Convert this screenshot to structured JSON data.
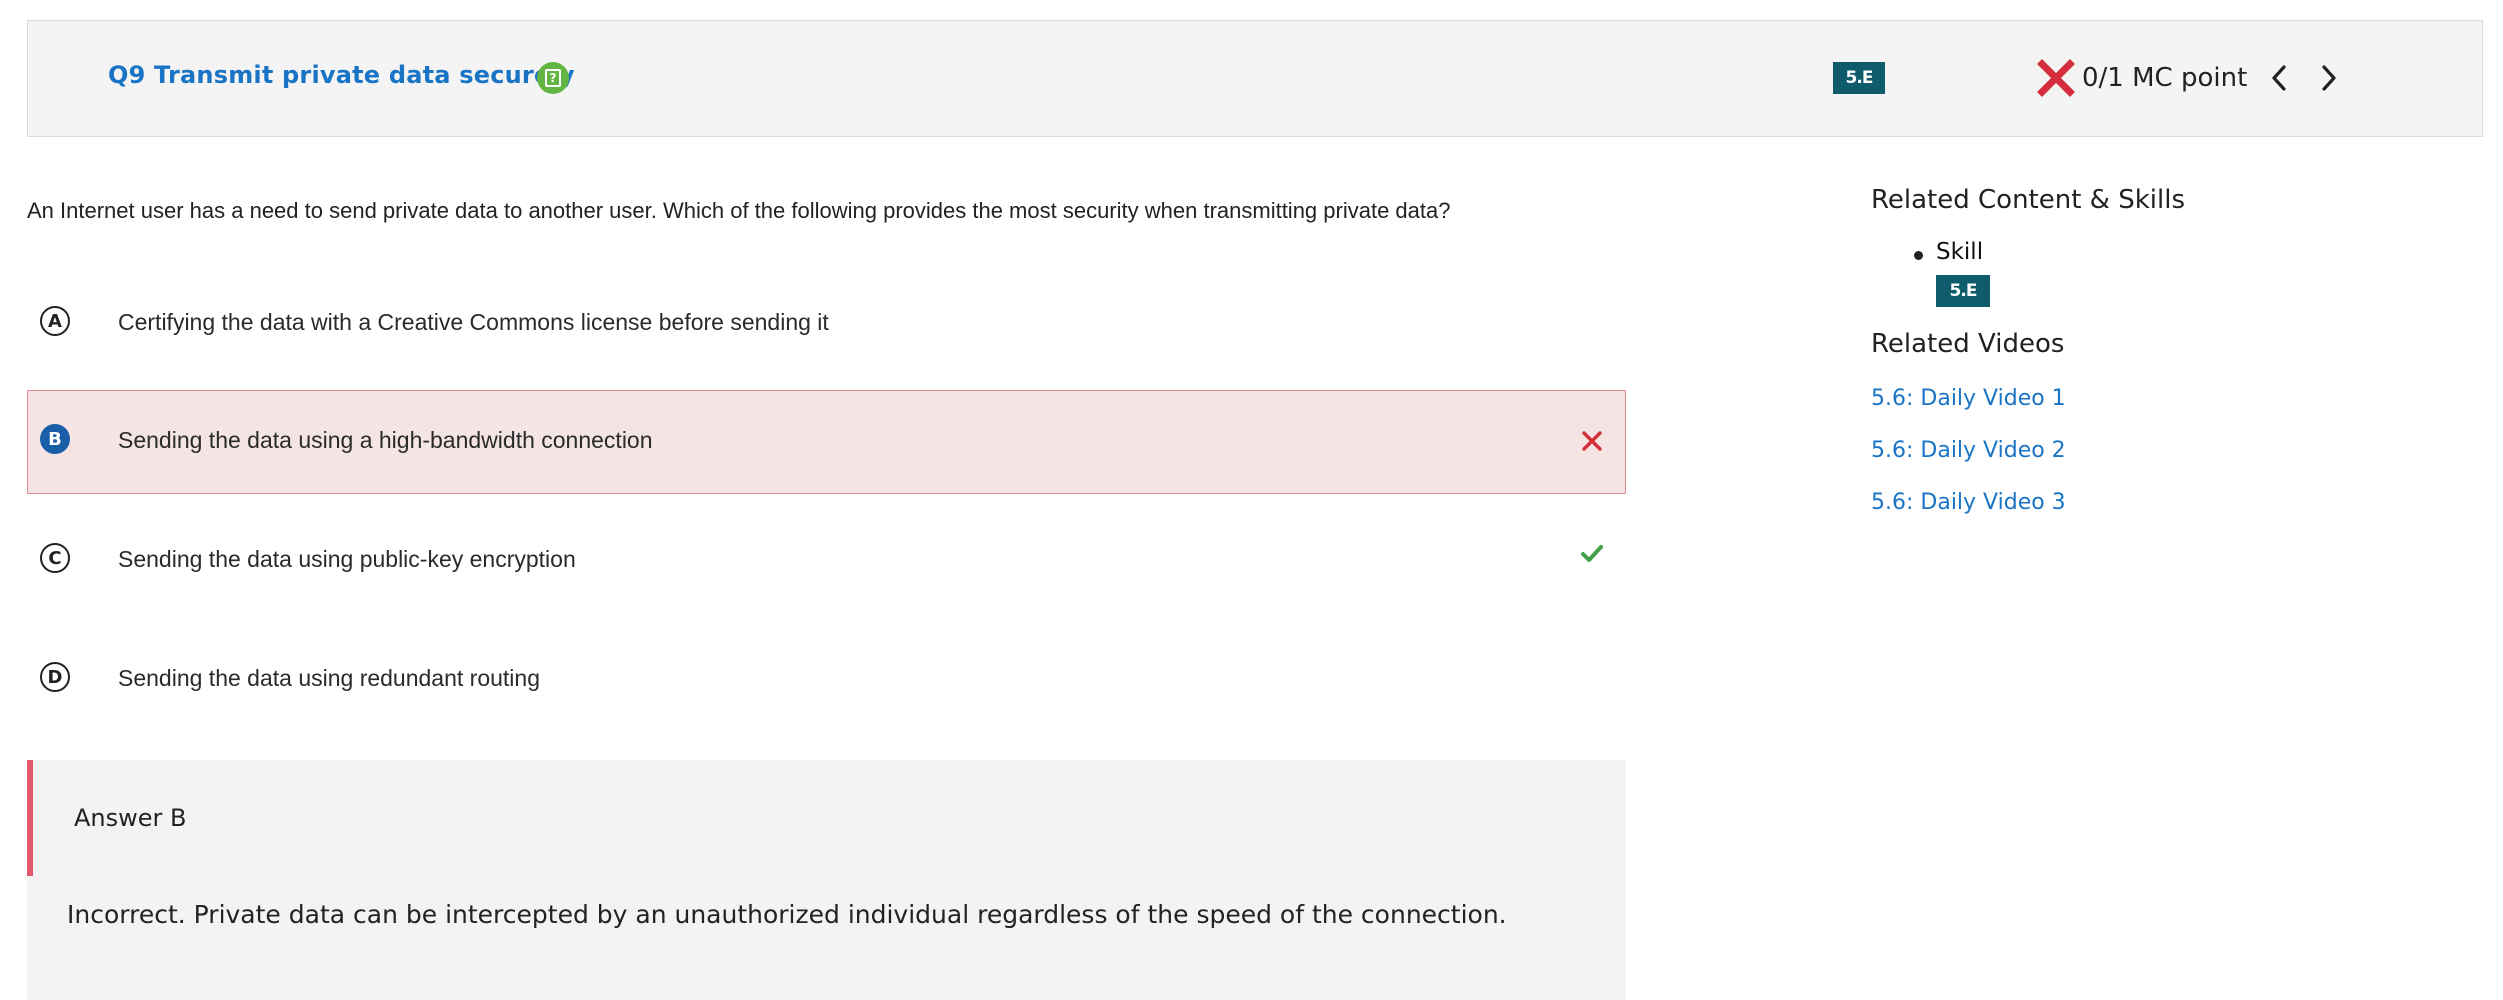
{
  "header": {
    "question_title": "Q9 Transmit private data securely",
    "skill_code": "5.E",
    "score_text": "0/1 MC point",
    "icons": {
      "question_status": "clipboard-question-icon",
      "result": "red-x-icon",
      "prev": "chevron-left-icon",
      "next": "chevron-right-icon"
    }
  },
  "question": {
    "text": "An Internet user has a need to send private data to another user. Which of the following provides the most security when transmitting private data?"
  },
  "options": [
    {
      "letter": "A",
      "text": "Certifying the data with a Creative Commons license before sending it",
      "state": "none"
    },
    {
      "letter": "B",
      "text": "Sending the data using a high-bandwidth connection",
      "state": "selected-incorrect"
    },
    {
      "letter": "C",
      "text": "Sending the data using public-key encryption",
      "state": "correct"
    },
    {
      "letter": "D",
      "text": "Sending the data using redundant routing",
      "state": "none"
    }
  ],
  "answer": {
    "title": "Answer B",
    "explanation": "Incorrect. Private data can be intercepted by an unauthorized individual regardless of the speed of the connection."
  },
  "sidebar": {
    "related_heading": "Related Content & Skills",
    "skill_label": "Skill",
    "skill_code": "5.E",
    "videos_heading": "Related Videos",
    "videos": [
      "5.6: Daily Video 1",
      "5.6: Daily Video 2",
      "5.6: Daily Video 3"
    ]
  },
  "colors": {
    "link": "#1a74c5",
    "badge": "#0d5b6b",
    "incorrect": "#d42e3c",
    "correct": "#43a047",
    "selected": "#1a5ea8",
    "wrong_bg": "#f4e4e4"
  }
}
